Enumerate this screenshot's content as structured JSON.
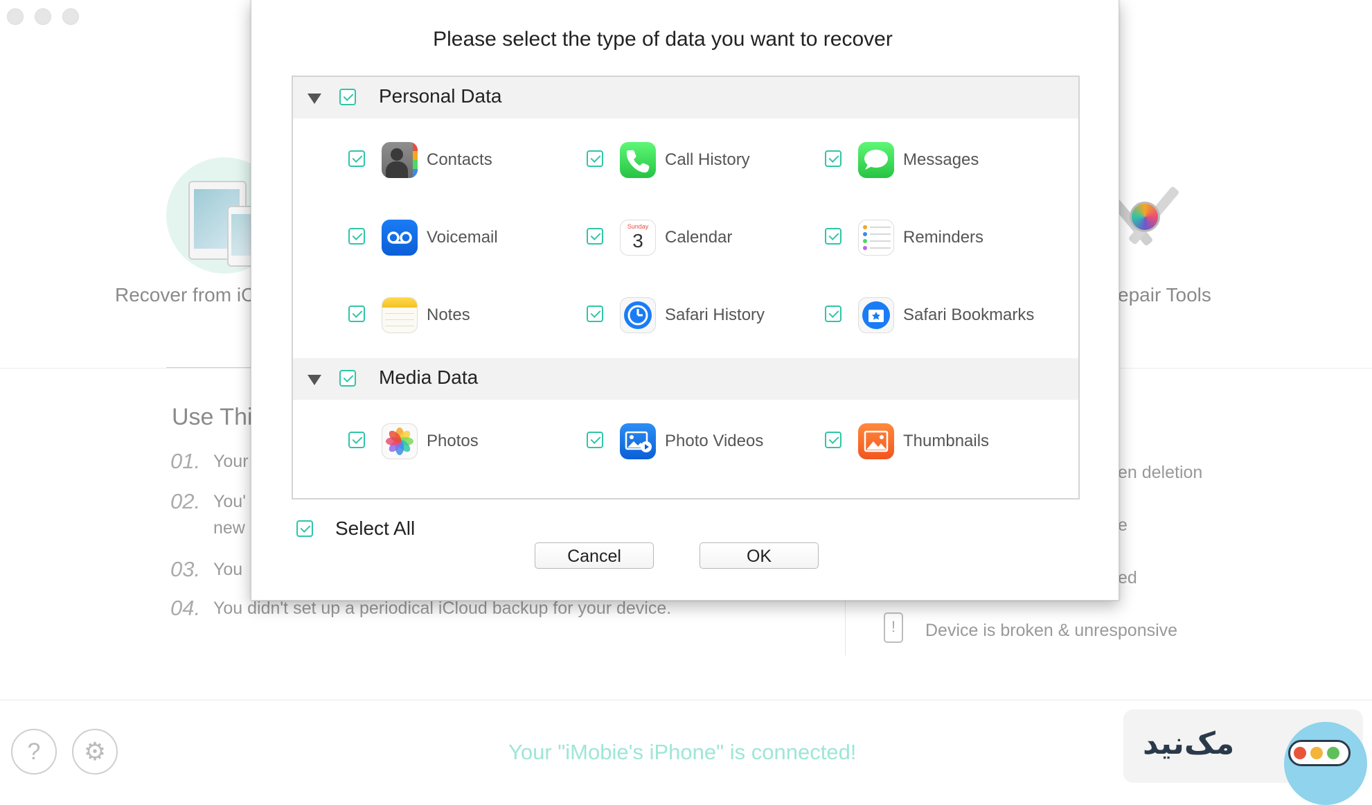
{
  "background": {
    "left_tab_label": "Recover from iC",
    "right_tab_label": "epair Tools",
    "use_heading": "Use Thi",
    "reasons": [
      {
        "num": "01.",
        "text": "Your"
      },
      {
        "num": "02.",
        "text": "You'",
        "text2": "new"
      },
      {
        "num": "03.",
        "text": "You"
      },
      {
        "num": "04.",
        "text": "You didn't set up a periodical iCloud backup for your device."
      }
    ],
    "right_items": [
      "en deletion",
      "e",
      "ed",
      "Device is broken & unresponsive"
    ],
    "status": "Your \"iMobie's iPhone\" is connected!",
    "watermark_text": "مک‌نید"
  },
  "modal": {
    "title": "Please select the type of data you want to recover",
    "sections": [
      {
        "title": "Personal Data",
        "items": [
          {
            "label": "Contacts",
            "icon": "contacts-icon"
          },
          {
            "label": "Call History",
            "icon": "phone-icon"
          },
          {
            "label": "Messages",
            "icon": "messages-icon"
          },
          {
            "label": "Voicemail",
            "icon": "voicemail-icon"
          },
          {
            "label": "Calendar",
            "icon": "calendar-icon",
            "icon_day": "Sunday",
            "icon_date": "3"
          },
          {
            "label": "Reminders",
            "icon": "reminders-icon"
          },
          {
            "label": "Notes",
            "icon": "notes-icon"
          },
          {
            "label": "Safari History",
            "icon": "safari-history-icon"
          },
          {
            "label": "Safari Bookmarks",
            "icon": "safari-bookmarks-icon"
          }
        ]
      },
      {
        "title": "Media Data",
        "items": [
          {
            "label": "Photos",
            "icon": "photos-icon"
          },
          {
            "label": "Photo Videos",
            "icon": "photo-videos-icon"
          },
          {
            "label": "Thumbnails",
            "icon": "thumbnails-icon"
          }
        ]
      }
    ],
    "select_all_label": "Select All",
    "cancel_label": "Cancel",
    "ok_label": "OK"
  },
  "colors": {
    "accent": "#2fc5a8",
    "status": "#9ee6d6"
  }
}
